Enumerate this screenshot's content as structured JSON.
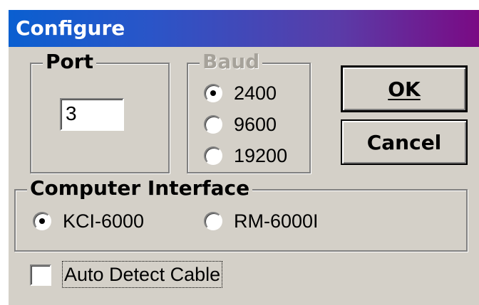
{
  "dialog": {
    "title": "Configure"
  },
  "port_group": {
    "legend": "Port",
    "value": "3"
  },
  "baud_group": {
    "legend": "Baud",
    "enabled": false,
    "options": [
      {
        "label": "2400",
        "selected": true
      },
      {
        "label": "9600",
        "selected": false
      },
      {
        "label": "19200",
        "selected": false
      }
    ]
  },
  "buttons": {
    "ok_label": "OK",
    "cancel_label": "Cancel"
  },
  "interface_group": {
    "legend": "Computer Interface",
    "options": [
      {
        "label": "KCI-6000",
        "selected": true
      },
      {
        "label": "RM-6000I",
        "selected": false
      }
    ]
  },
  "auto_detect": {
    "label": "Auto Detect Cable",
    "checked": false
  },
  "colors": {
    "dialog_face": "#d4d0c8",
    "title_gradient_start": "#0a5fd0",
    "title_gradient_end": "#7a0a84",
    "disabled_text": "#a6a29a"
  }
}
